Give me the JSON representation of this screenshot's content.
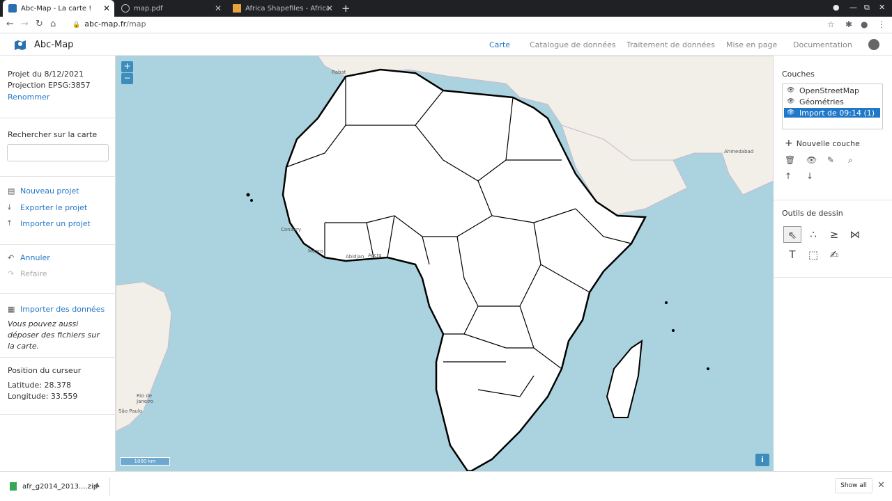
{
  "browser": {
    "tabs": [
      {
        "title": "Abc-Map - La carte !",
        "active": true
      },
      {
        "title": "map.pdf",
        "active": false
      },
      {
        "title": "Africa Shapefiles - Africa shap",
        "active": false
      }
    ],
    "url_domain": "abc-map.fr",
    "url_path": "/map"
  },
  "app": {
    "brand": "Abc-Map",
    "nav": [
      "Carte",
      "Catalogue de données",
      "Traitement de données",
      "Mise en page",
      "Documentation"
    ]
  },
  "left": {
    "project_date": "Projet du 8/12/2021",
    "projection": "Projection EPSG:3857",
    "rename": "Renommer",
    "search_label": "Rechercher sur la carte",
    "new_project": "Nouveau projet",
    "export_project": "Exporter le projet",
    "import_project": "Importer un projet",
    "undo": "Annuler",
    "redo": "Refaire",
    "import_data": "Importer des données",
    "drop_hint": "Vous pouvez aussi déposer des fichiers sur la carte.",
    "cursor_title": "Position du curseur",
    "latitude": "Latitude: 28.378",
    "longitude": "Longitude: 33.559"
  },
  "map": {
    "zoom_in": "+",
    "zoom_out": "−",
    "scale": "1000 km",
    "info": "i",
    "labels": [
      "Rabat",
      "Conakry",
      "Monro",
      "Abidjan",
      "Accra",
      "Rio de Janeiro",
      "São Paulo",
      "Ahmedabad"
    ]
  },
  "right": {
    "layers_title": "Couches",
    "layers": [
      "OpenStreetMap",
      "Géométries",
      "Import de 09:14 (1)"
    ],
    "new_layer": "Nouvelle couche",
    "draw_title": "Outils de dessin"
  },
  "downloads": {
    "filename": "afr_g2014_2013....zip",
    "show_all": "Show all"
  }
}
